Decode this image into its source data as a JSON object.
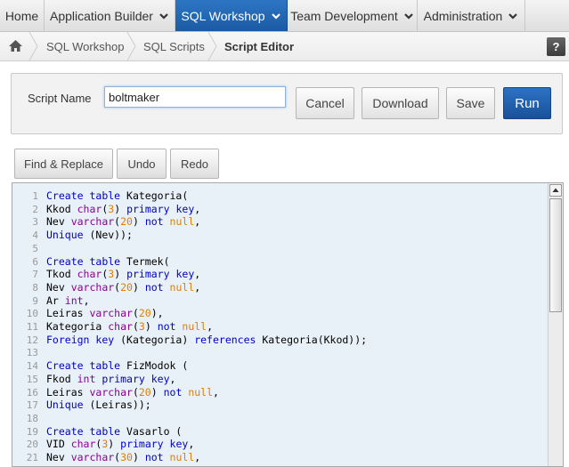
{
  "nav": {
    "tabs": [
      {
        "label": "Home",
        "dropdown": false
      },
      {
        "label": "Application Builder",
        "dropdown": true
      },
      {
        "label": "SQL Workshop",
        "dropdown": true,
        "active": true
      },
      {
        "label": "Team Development",
        "dropdown": true
      },
      {
        "label": "Administration",
        "dropdown": true
      }
    ]
  },
  "breadcrumb": {
    "items": [
      "SQL Workshop",
      "SQL Scripts"
    ],
    "current": "Script Editor",
    "help": "?"
  },
  "script": {
    "name_label": "Script Name",
    "name_value": "boltmaker",
    "cancel": "Cancel",
    "download": "Download",
    "save": "Save",
    "run": "Run"
  },
  "toolbar": {
    "find_replace": "Find & Replace",
    "undo": "Undo",
    "redo": "Redo"
  },
  "editor": {
    "lines": [
      "Create table Kategoria(",
      "Kkod char(3) primary key,",
      "Nev varchar(20) not null,",
      "Unique (Nev));",
      "",
      "Create table Termek(",
      "Tkod char(3) primary key,",
      "Nev varchar(20) not null,",
      "Ar int,",
      "Leiras varchar(20),",
      "Kategoria char(3) not null,",
      "Foreign key (Kategoria) references Kategoria(Kkod));",
      "",
      "Create table FizModok (",
      "Fkod int primary key,",
      "Leiras varchar(20) not null,",
      "Unique (Leiras));",
      "",
      "Create table Vasarlo (",
      "VID char(3) primary key,",
      "Nev varchar(30) not null,"
    ]
  },
  "colors": {
    "accent": "#1f5fa8",
    "editor_bg": "#e8f0f8",
    "keyword": "#0000c8",
    "type": "#8b0093",
    "number": "#e08000"
  }
}
